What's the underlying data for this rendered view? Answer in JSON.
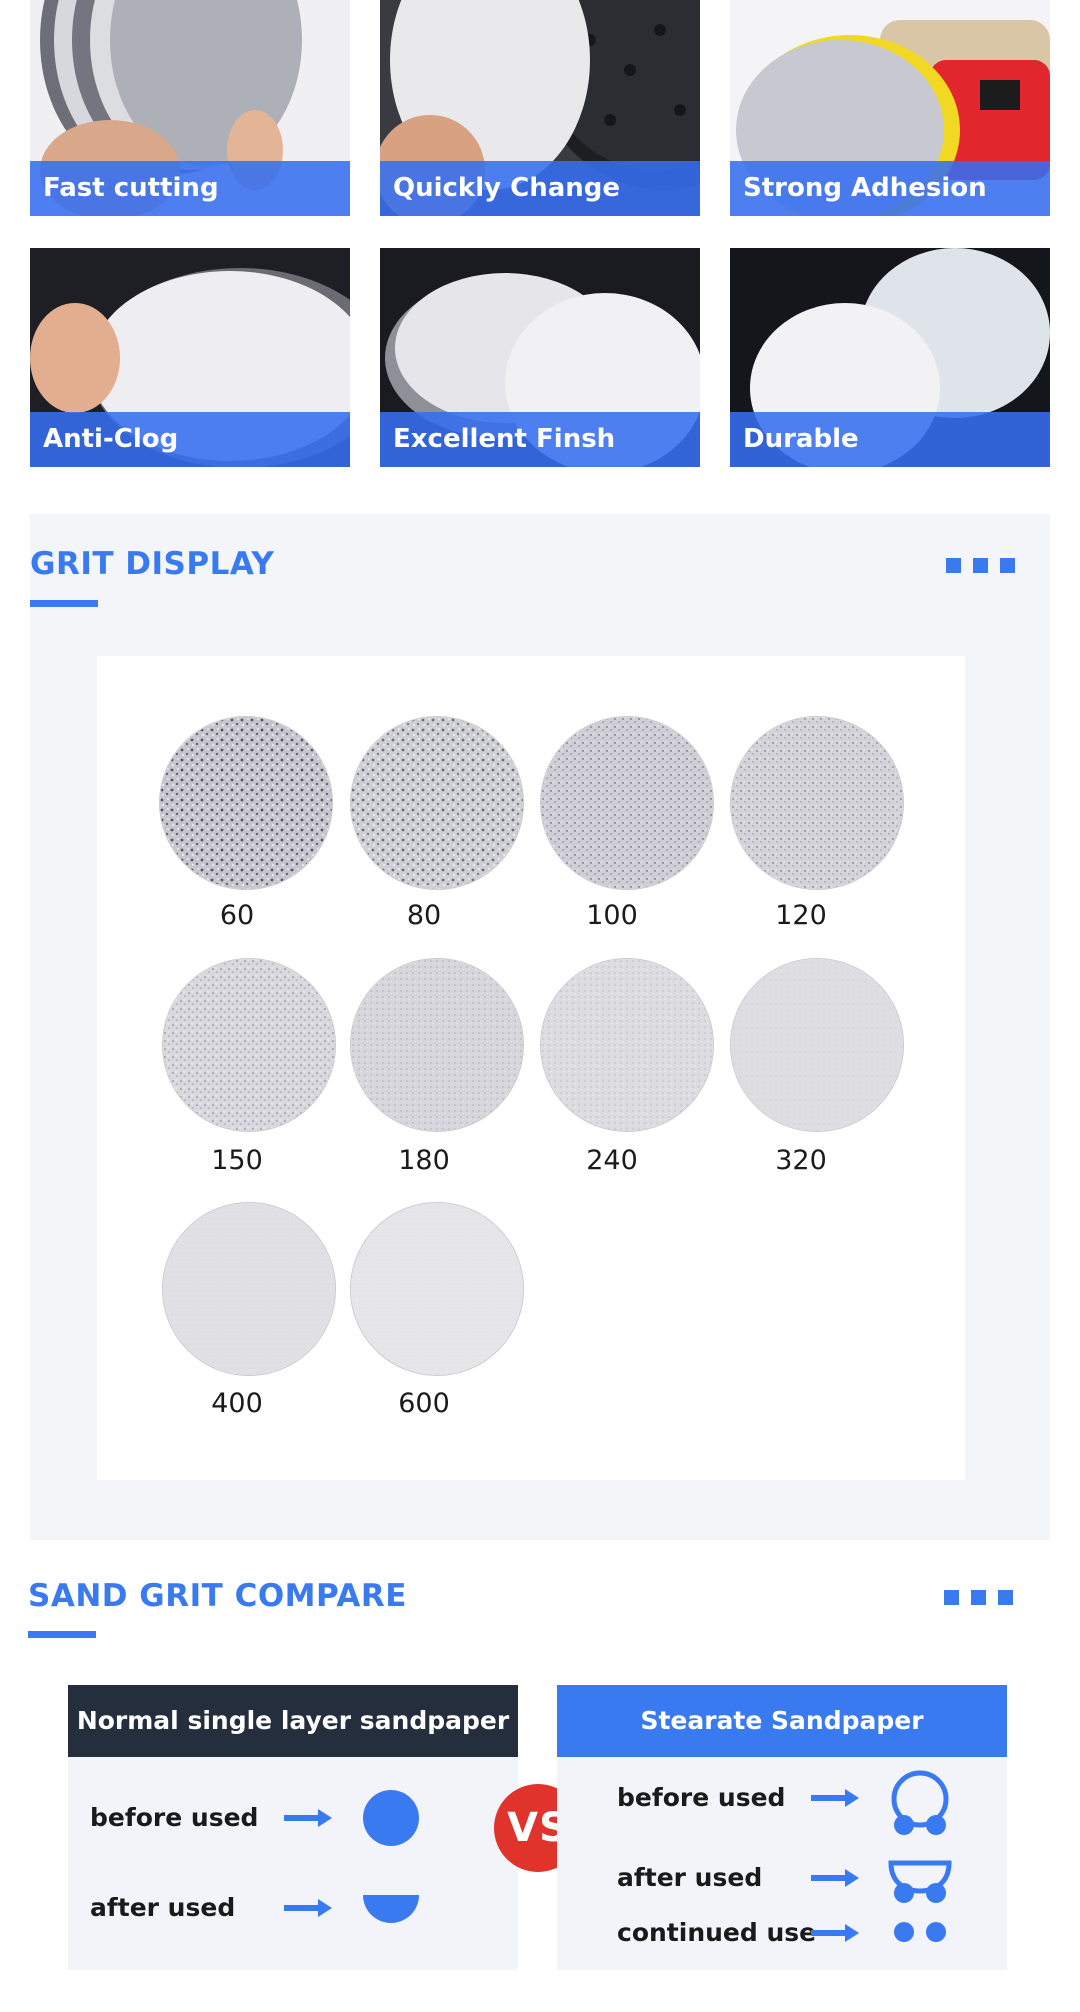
{
  "features": [
    {
      "label": "Fast cutting"
    },
    {
      "label": "Quickly Change"
    },
    {
      "label": "Strong Adhesion"
    },
    {
      "label": "Anti-Clog"
    },
    {
      "label": "Excellent Finsh"
    },
    {
      "label": "Durable"
    }
  ],
  "grit_display": {
    "title": "GRIT DISPLAY",
    "grits": [
      "60",
      "80",
      "100",
      "120",
      "150",
      "180",
      "240",
      "320",
      "400",
      "600"
    ]
  },
  "compare": {
    "title": "SAND GRIT COMPARE",
    "left": {
      "title": "Normal single layer sandpaper",
      "rows": [
        "before used",
        "after used"
      ]
    },
    "vs": "VS",
    "right": {
      "title": "Stearate Sandpaper",
      "rows": [
        "before used",
        "after used",
        "continued use"
      ]
    }
  },
  "colors": {
    "accent": "#3a7af0",
    "dark_header": "#252e3d",
    "vs_red": "#e0332b",
    "panel_bg": "#f4f5f9"
  }
}
